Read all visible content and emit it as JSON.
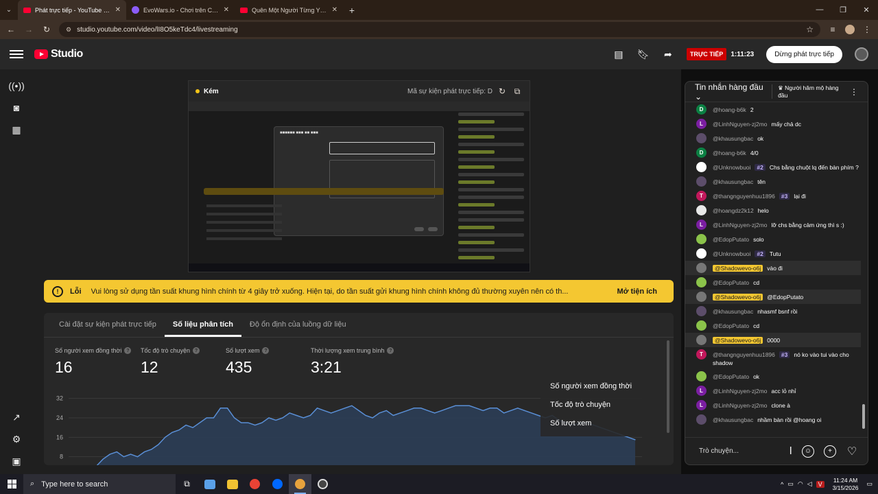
{
  "browser": {
    "tabs": [
      {
        "label": "Phát trực tiếp - YouTube Studio",
        "active": true
      },
      {
        "label": "EvoWars.io - Chơi trên Crazy",
        "active": false
      },
      {
        "label": "Quên Một Người Từng Yêu (Tu",
        "active": false
      }
    ],
    "url": "studio.youtube.com/video/lI8O5keTdc4/livestreaming"
  },
  "header": {
    "brand": "Studio",
    "live_badge": "TRỰC TIẾP",
    "live_time": "1:11:23",
    "stop_button": "Dừng phát trực tiếp"
  },
  "preview": {
    "quality": "Kém",
    "event_label": "Mã sự kiện phát trực tiếp: D"
  },
  "error": {
    "title": "Lỗi",
    "message": "Vui lòng sử dụng tần suất khung hình chính từ 4 giây trở xuống. Hiện tại, do tần suất gửi khung hình chính không đủ thường xuyên nên có th...",
    "action": "Mở tiện ích"
  },
  "tabs": [
    {
      "label": "Cài đặt sự kiện phát trực tiếp"
    },
    {
      "label": "Số liệu phân tích"
    },
    {
      "label": "Độ ổn định của luồng dữ liệu"
    }
  ],
  "metrics": [
    {
      "label": "Số người xem đồng thời",
      "value": "16"
    },
    {
      "label": "Tốc độ trò chuyện",
      "value": "12"
    },
    {
      "label": "Số lượt xem",
      "value": "435"
    },
    {
      "label": "Thời lượng xem trung bình",
      "value": "3:21"
    }
  ],
  "legend": [
    "Số người xem đồng thời",
    "Tốc độ trò chuyện",
    "Số lượt xem"
  ],
  "chart_data": {
    "type": "area",
    "yticks": [
      "32",
      "24",
      "16",
      "8"
    ],
    "ylim": [
      0,
      36
    ],
    "series": [
      {
        "values": [
          2,
          4,
          7,
          9,
          10,
          8,
          9,
          8,
          10,
          11,
          13,
          16,
          18,
          19,
          21,
          20,
          22,
          24,
          24,
          28,
          28,
          24,
          22,
          22,
          21,
          22,
          24,
          23,
          24,
          26,
          25,
          24,
          25,
          28,
          27,
          26,
          27,
          28,
          29,
          27,
          25,
          24,
          26,
          27,
          25,
          26,
          27,
          28,
          28,
          27,
          26,
          27,
          28,
          29,
          29,
          29,
          28,
          27,
          28,
          28,
          26,
          27,
          28,
          27,
          26,
          25,
          24,
          25,
          23,
          22,
          21,
          22,
          22,
          21,
          20,
          19,
          18,
          17,
          16,
          15
        ]
      }
    ],
    "colors": {
      "line": "#5a8fd6",
      "fill": "#2c3e58"
    }
  },
  "chat": {
    "mode": "Tin nhắn hàng đầu",
    "sub_filter": "Người hâm mộ hàng đầu",
    "input_placeholder": "Trò chuyện...",
    "messages": [
      {
        "author": "@hoang-b6k",
        "text": "2",
        "initial": "D",
        "color": "#0b8043",
        "badge": "",
        "mod": false
      },
      {
        "author": "@LinhNguyen-zj2mo",
        "text": "mấy chả dc",
        "initial": "L",
        "color": "#7b1fa2",
        "badge": "",
        "mod": false
      },
      {
        "author": "@khausungbac",
        "text": "ok",
        "initial": "",
        "color": "#5c4d6a",
        "badge": "",
        "mod": false
      },
      {
        "author": "@hoang-b6k",
        "text": "4/0",
        "initial": "D",
        "color": "#0b8043",
        "badge": "",
        "mod": false
      },
      {
        "author": "@Unknowbuoi",
        "text": "Chs bằng chuột lq đến bàn phím ?",
        "initial": "",
        "color": "#ffffff",
        "badge": "#2",
        "mod": false
      },
      {
        "author": "@khausungbac",
        "text": "tên",
        "initial": "",
        "color": "#5c4d6a",
        "badge": "",
        "mod": false
      },
      {
        "author": "@thangnguyenhuu1896",
        "text": "lại đi",
        "initial": "T",
        "color": "#c2185b",
        "badge": "#3",
        "mod": false
      },
      {
        "author": "@hoangdz2k12",
        "text": "helo",
        "initial": "",
        "color": "#e8e8e8",
        "badge": "",
        "mod": false
      },
      {
        "author": "@LinhNguyen-zj2mo",
        "text": "lỡ chs bằng cảm ứng thì s :)",
        "initial": "L",
        "color": "#7b1fa2",
        "badge": "",
        "mod": false
      },
      {
        "author": "@EdopPutato",
        "text": "solo",
        "initial": "",
        "color": "#8bc34a",
        "badge": "",
        "mod": false
      },
      {
        "author": "@Unknowbuoi",
        "text": "Tutu",
        "initial": "",
        "color": "#ffffff",
        "badge": "#2",
        "mod": false
      },
      {
        "author": "@Shadowevo-o6j",
        "text": "vào đi",
        "initial": "",
        "color": "#777777",
        "badge": "",
        "mod": true
      },
      {
        "author": "@EdopPutato",
        "text": "cd",
        "initial": "",
        "color": "#8bc34a",
        "badge": "",
        "mod": false
      },
      {
        "author": "@Shadowevo-o6j",
        "text": "@EdopPutato",
        "initial": "",
        "color": "#777777",
        "badge": "",
        "mod": true
      },
      {
        "author": "@khausungbac",
        "text": "nhasmf bsnf rồi",
        "initial": "",
        "color": "#5c4d6a",
        "badge": "",
        "mod": false
      },
      {
        "author": "@EdopPutato",
        "text": "cd",
        "initial": "",
        "color": "#8bc34a",
        "badge": "",
        "mod": false
      },
      {
        "author": "@Shadowevo-o6j",
        "text": "0000",
        "initial": "",
        "color": "#777777",
        "badge": "",
        "mod": true
      },
      {
        "author": "@thangnguyenhuu1896",
        "text": "nó ko vào tui vào cho shadow",
        "initial": "T",
        "color": "#c2185b",
        "badge": "#3",
        "mod": false
      },
      {
        "author": "@EdopPutato",
        "text": "ok",
        "initial": "",
        "color": "#8bc34a",
        "badge": "",
        "mod": false
      },
      {
        "author": "@LinhNguyen-zj2mo",
        "text": "acc lỏ nhỉ",
        "initial": "L",
        "color": "#7b1fa2",
        "badge": "",
        "mod": false
      },
      {
        "author": "@LinhNguyen-zj2mo",
        "text": "clone à",
        "initial": "L",
        "color": "#7b1fa2",
        "badge": "",
        "mod": false
      },
      {
        "author": "@khausungbac",
        "text": "nhầm bàn rồi @hoang oi",
        "initial": "",
        "color": "#5c4d6a",
        "badge": "",
        "mod": false
      }
    ]
  },
  "taskbar": {
    "search_placeholder": "Type here to search",
    "time": "11:24 AM",
    "date": "3/15/2026"
  }
}
